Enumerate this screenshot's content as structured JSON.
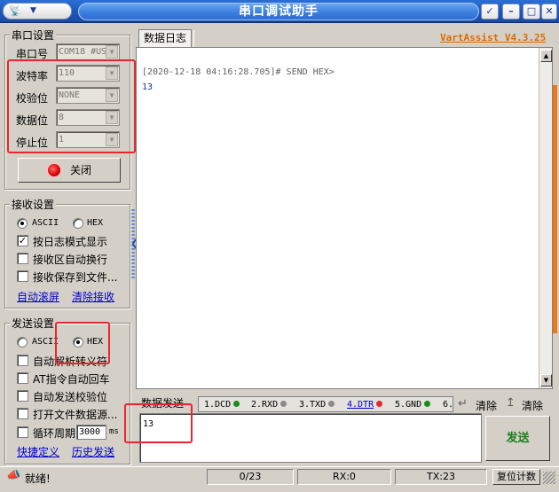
{
  "window": {
    "title": "串口调试助手",
    "brand": "VartAssist V4.3.25",
    "accent": "#1d54b5"
  },
  "serial_settings": {
    "title": "串口设置",
    "port_label": "串口号",
    "port_value": "COM18 #US",
    "baud_label": "波特率",
    "baud_value": "110",
    "parity_label": "校验位",
    "parity_value": "NONE",
    "databits_label": "数据位",
    "databits_value": "8",
    "stopbits_label": "停止位",
    "stopbits_value": "1",
    "close_button": "关闭"
  },
  "receive_settings": {
    "title": "接收设置",
    "ascii": "ASCII",
    "hex": "HEX",
    "mode_selected": "ASCII",
    "log_mode": {
      "label": "按日志模式显示",
      "checked": true
    },
    "auto_wrap": {
      "label": "接收区自动换行",
      "checked": false
    },
    "save_to_file": {
      "label": "接收保存到文件...",
      "checked": false
    },
    "auto_scroll_link": "自动滚屏",
    "clear_link": "清除接收"
  },
  "send_settings": {
    "title": "发送设置",
    "ascii": "ASCII",
    "hex": "HEX",
    "mode_selected": "HEX",
    "parse_escape": {
      "label": "自动解析转义符",
      "checked": false
    },
    "at_enter": {
      "label": "AT指令自动回车",
      "checked": false
    },
    "checksum": {
      "label": "自动发送校验位",
      "checked": false
    },
    "open_file": {
      "label": "打开文件数据源...",
      "checked": false
    },
    "cycle": {
      "label": "循环周期",
      "checked": false,
      "value": "3000",
      "unit": "ms"
    },
    "shortcut_link": "快捷定义",
    "history_link": "历史发送"
  },
  "log": {
    "tab": "数据日志",
    "line1": "[2020-12-18 04:16:28.705]# SEND HEX>",
    "line2": "13"
  },
  "send": {
    "tab": "数据发送",
    "signals": [
      {
        "label": "1.DCD",
        "color": "#1a8c1a"
      },
      {
        "label": "2.RXD",
        "color": "#8a8a8a"
      },
      {
        "label": "3.TXD",
        "color": "#8a8a8a"
      },
      {
        "label": "4.DTR",
        "color": "#e8262e"
      },
      {
        "label": "5.GND",
        "color": "#1a8c1a"
      },
      {
        "label": "6.",
        "color": ""
      }
    ],
    "clear1": "清除",
    "clear2": "清除",
    "input_value": "13",
    "send_button": "发送"
  },
  "status": {
    "ready": "就绪!",
    "progress": "0/23",
    "rx": "RX:0",
    "tx": "TX:23",
    "reset": "复位计数"
  }
}
